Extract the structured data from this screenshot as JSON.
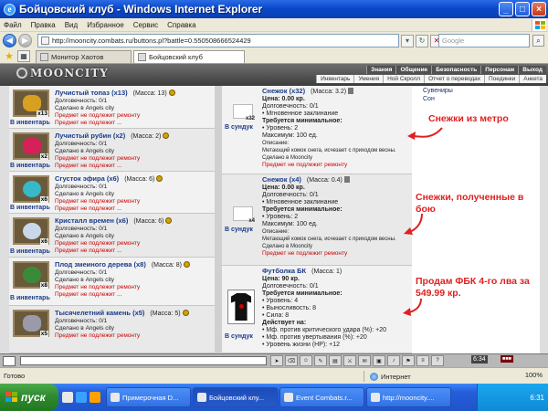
{
  "window": {
    "title": "Бойцовский клуб - Windows Internet Explorer"
  },
  "menu": [
    "Файл",
    "Правка",
    "Вид",
    "Избранное",
    "Сервис",
    "Справка"
  ],
  "address": {
    "url": "http://mooncity.combats.ru/buttons.pl?battle=0.550508666524429",
    "search_placeholder": "Google"
  },
  "tabs": [
    {
      "label": "Монитор Хаотов",
      "active": false
    },
    {
      "label": "Бойцовский клуб",
      "active": true
    }
  ],
  "site": {
    "logo": "MOONCITY",
    "nav_top": [
      "Знания",
      "Общение",
      "Безопасность",
      "Персонаж",
      "Выход"
    ],
    "nav_bottom": [
      "Инвентарь",
      "Умения",
      "Ной Скролл",
      "Отчет о переводах",
      "Поединки",
      "Анкета"
    ],
    "right_menu": [
      "Сувениры",
      "Сон"
    ]
  },
  "inventory": {
    "link_label": "В инвентарь",
    "items": [
      {
        "name": "Лучистый топаз (x13)",
        "mass": "(Масса: 13)",
        "durability": "Долговечность: 0/1",
        "made": "Сделано в Angels city",
        "warn1": "Предмет не подлежит ремонту",
        "warn2": "Предмет не подлежит ...",
        "qty": "x13",
        "color": "#d8a020"
      },
      {
        "name": "Лучистый рубин (x2)",
        "mass": "(Масса: 2)",
        "durability": "Долговечность: 0/1",
        "made": "Сделано в Angels city",
        "warn1": "Предмет не подлежит ремонту",
        "warn2": "Предмет не подлежит ...",
        "qty": "x2",
        "color": "#d6205a"
      },
      {
        "name": "Сгусток эфира (x6)",
        "mass": "(Масса: 6)",
        "durability": "Долговечность: 0/1",
        "made": "Сделано в Angels city",
        "warn1": "Предмет не подлежит ремонту",
        "warn2": "Предмет не подлежит ...",
        "qty": "x6",
        "color": "#38b8c8"
      },
      {
        "name": "Кристалл времен (x6)",
        "mass": "(Масса: 6)",
        "durability": "Долговечность: 0/1",
        "made": "Сделано в Angels city",
        "warn1": "Предмет не подлежит ремонту",
        "warn2": "Предмет не подлежит ...",
        "qty": "x6",
        "color": "#c9d7ea"
      },
      {
        "name": "Плод змеиного дерева (x8)",
        "mass": "(Масса: 8)",
        "durability": "Долговечность: 0/1",
        "made": "Сделано в Angels city",
        "warn1": "Предмет не подлежит ремонту",
        "warn2": "Предмет не подлежит ...",
        "qty": "x8",
        "color": "#3a8a3a"
      },
      {
        "name": "Тысячелетний камень (x5)",
        "mass": "(Масса: 5)",
        "durability": "Долговечность: 0/1",
        "made": "Сделано в Angels city",
        "warn1": "Предмет не подлежит ремонту",
        "warn2": "",
        "qty": "x5",
        "color": "#9a9aa8"
      }
    ]
  },
  "chest": {
    "link_label": "В сундук",
    "items": [
      {
        "name": "Снежок (x32)",
        "mass": "(Масса: 3.2)",
        "price": "Цена: 0.00 кр.",
        "durability": "Долговечность: 0/1",
        "feature": "• Мгновенное заклинание",
        "req_title": "Требуется минимальное:",
        "req1": "• Уровень: 2",
        "extra": "Максимум: 100 ед.",
        "desc_title": "Описание:",
        "desc": "Метающий комок снега, исчезает с приходом весны.",
        "made": "Сделано в Mooncity",
        "warn": "Предмет не подлежит ремонту",
        "qty": "x32"
      },
      {
        "name": "Снежок (x4)",
        "mass": "(Масса: 0.4)",
        "price": "Цена: 0.00 кр.",
        "durability": "Долговечность: 0/1",
        "feature": "• Мгновенное заклинание",
        "req_title": "Требуется минимальное:",
        "req1": "• Уровень: 2",
        "extra": "Максимум: 100 ед.",
        "desc_title": "Описание:",
        "desc": "Метающий комок снега, исчезает с приходом весны.",
        "made": "Сделано в Mooncity",
        "warn": "Предмет не подлежит ремонту",
        "qty": "x4"
      },
      {
        "name": "Футболка БК",
        "mass": "(Масса: 1)",
        "price": "Цена: 90 кр.",
        "durability": "Долговечность: 0/1",
        "req_title": "Требуется минимальное:",
        "req1": "• Уровень: 4",
        "req2": "• Выносливость: 8",
        "req3": "• Сила: 8",
        "acts_title": "Действует на:",
        "act1": "• Мф. против критического удара (%): +20",
        "act2": "• Мф. против увертывания (%): +20",
        "act3": "• Уровень жизни (HP): +12"
      }
    ]
  },
  "annotations": {
    "a1": "Снежки из метро",
    "a2": "Снежки, полученные в бою",
    "a3": "Продам ФБК 4-го лва за 549.99 кр."
  },
  "chatbar": {
    "clock": "6:34"
  },
  "status": {
    "left": "Готово",
    "zone": "Интернет",
    "zoom": "100%"
  },
  "taskbar": {
    "start": "пуск",
    "tasks": [
      "Примерочная D...",
      "Бойцовский клу...",
      "Event Combats.r...",
      "http://mooncity...."
    ],
    "clock": "6:31"
  },
  "colors": {
    "annotation": "#e02020",
    "link": "#1a3b8a",
    "warning": "#cc0000"
  }
}
